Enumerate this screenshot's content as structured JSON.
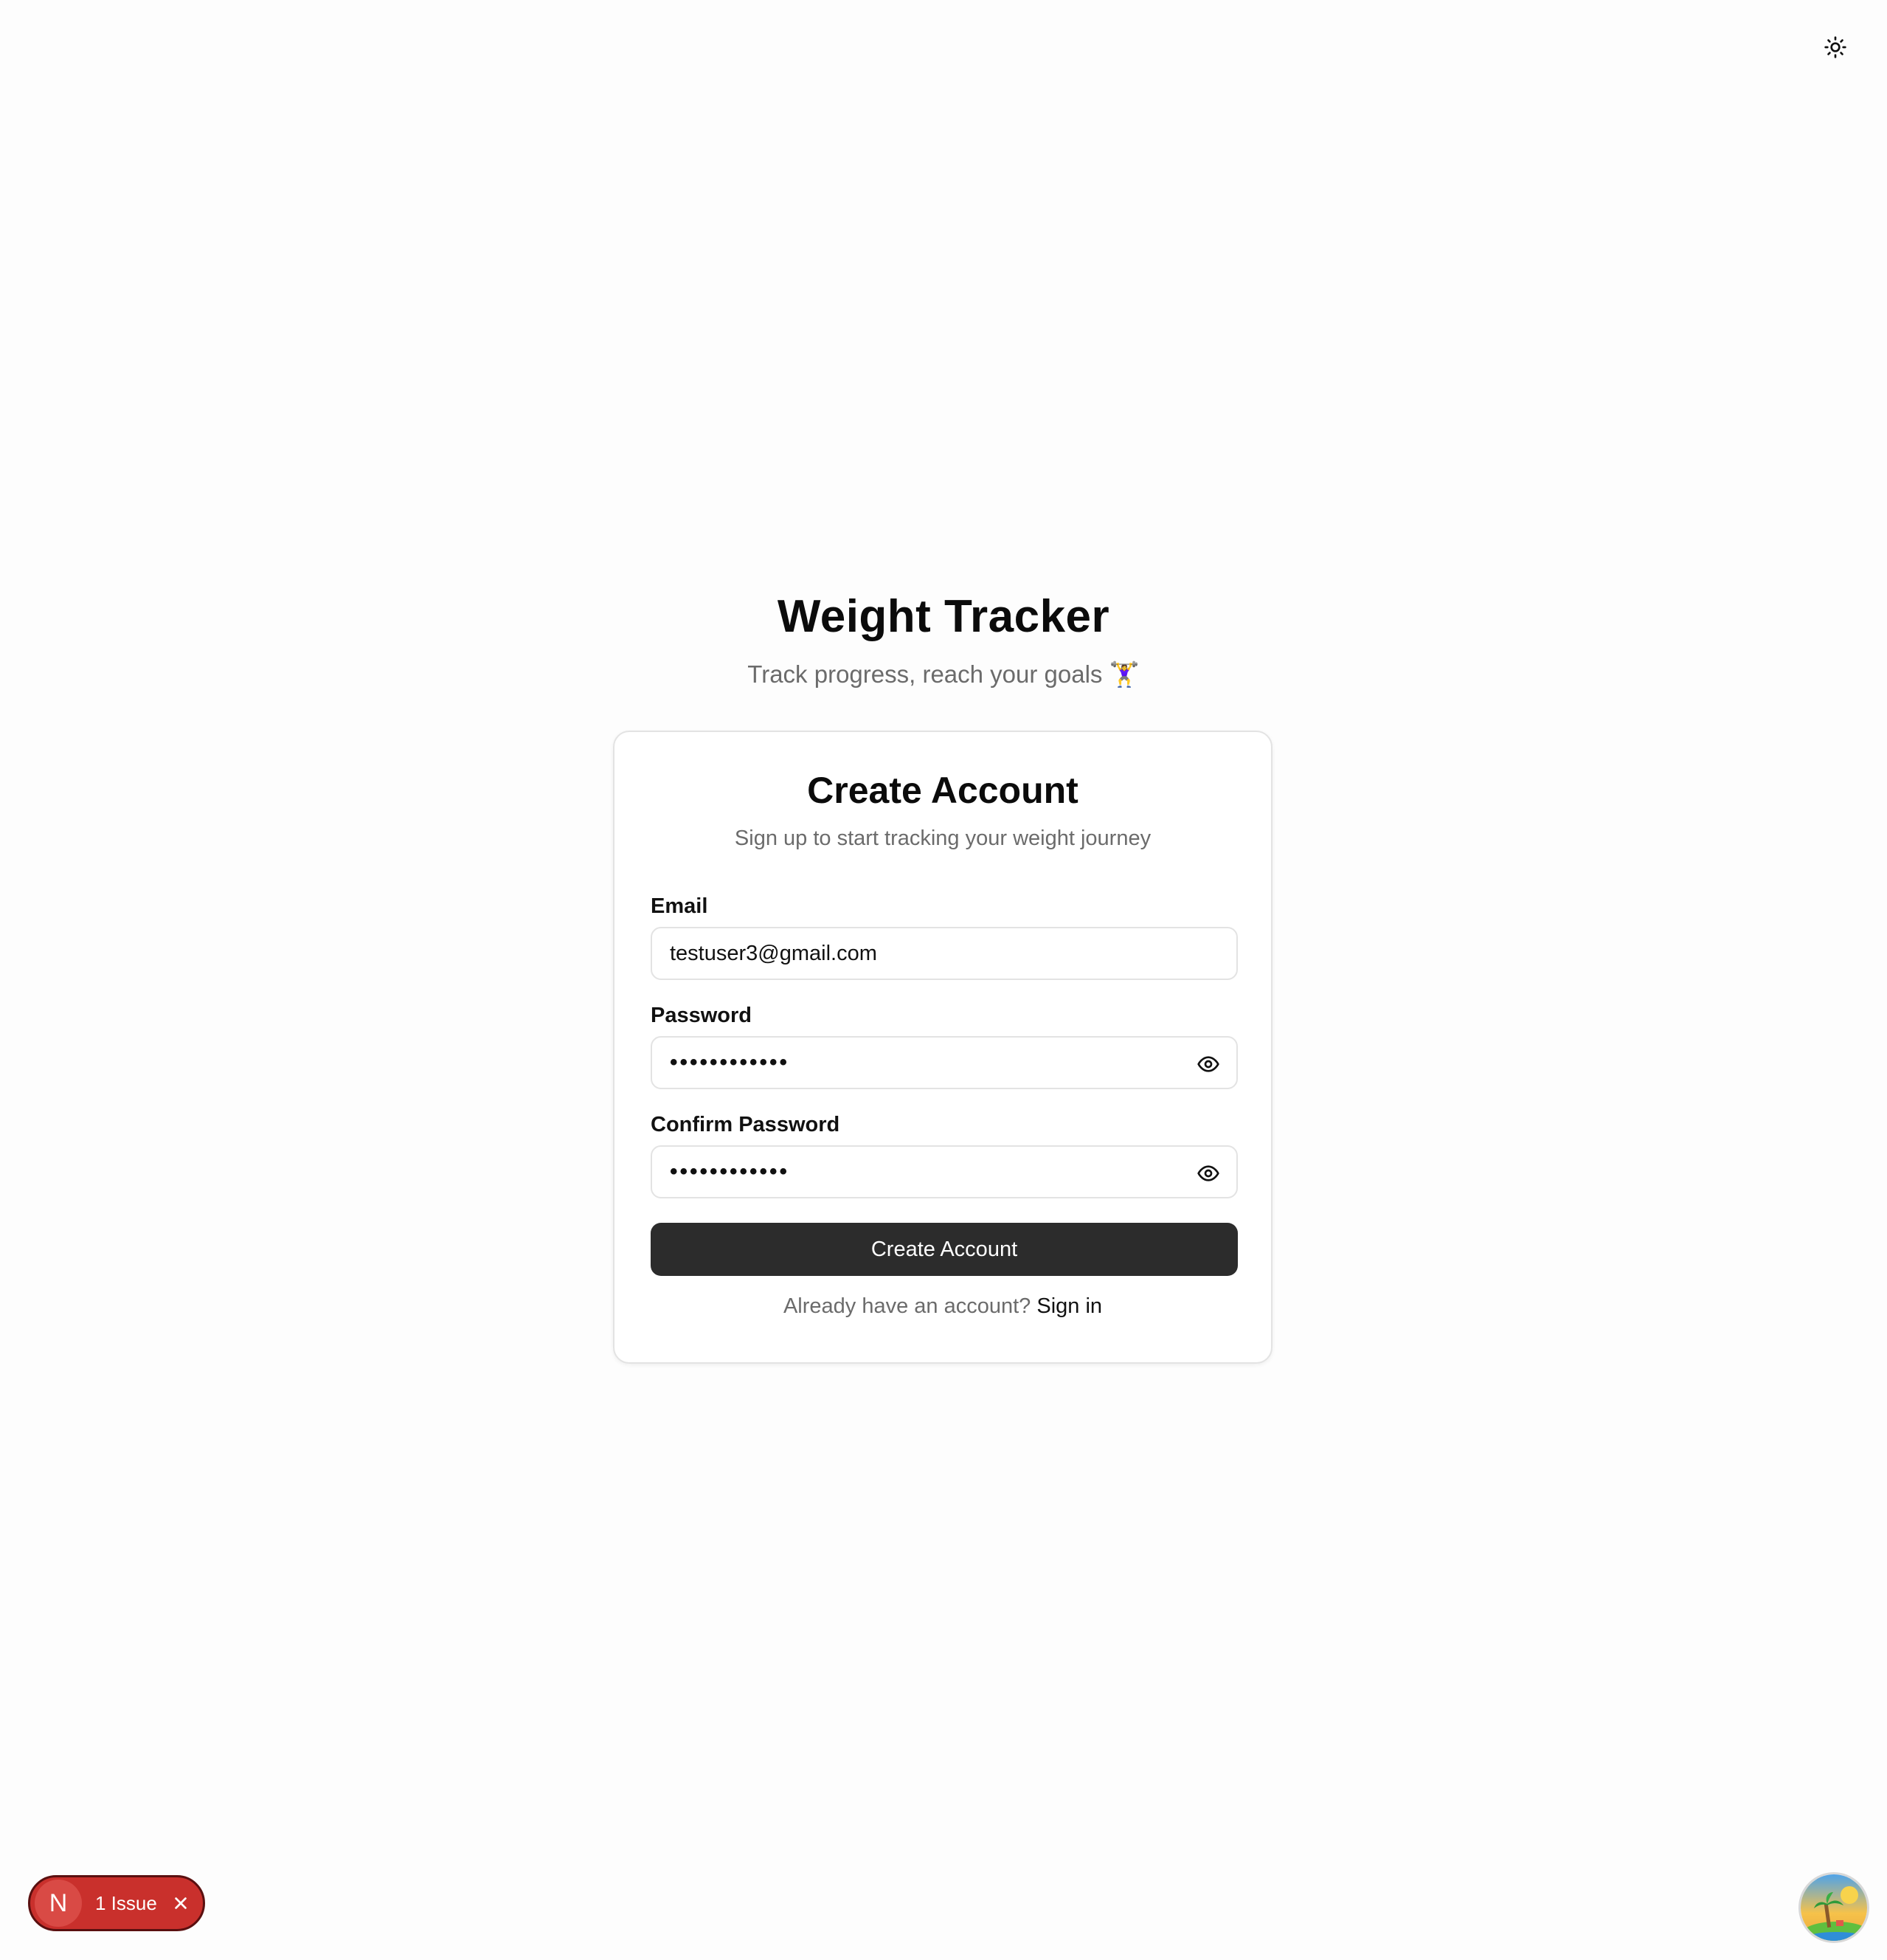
{
  "header": {
    "title": "Weight Tracker",
    "subtitle": "Track progress, reach your goals",
    "subtitle_emoji": "🏋️‍♀️"
  },
  "card": {
    "title": "Create Account",
    "description": "Sign up to start tracking your weight journey",
    "email": {
      "label": "Email",
      "value": "testuser3@gmail.com"
    },
    "password": {
      "label": "Password",
      "masked_value": "••••••••••••"
    },
    "confirm_password": {
      "label": "Confirm Password",
      "masked_value": "••••••••••••"
    },
    "submit_label": "Create Account",
    "footer_text": "Already have an account?",
    "signin_label": "Sign in"
  },
  "dev_overlay": {
    "badge_letter": "N",
    "issue_label": "1 Issue",
    "color": "#c9302c"
  },
  "icons": {
    "theme_toggle": "sun-icon",
    "password_visibility": "eye-icon",
    "close": "close-icon"
  },
  "colors": {
    "primary_button": "#2c2c2c",
    "muted_text": "#6b6b6b",
    "border": "#e3e3e3"
  }
}
